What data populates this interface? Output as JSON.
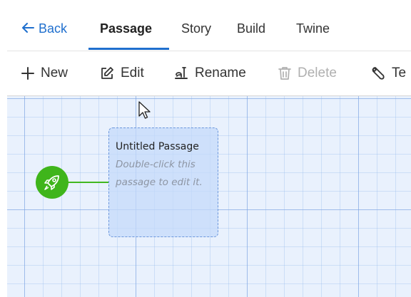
{
  "nav": {
    "back_label": "Back",
    "tabs": [
      {
        "label": "Passage",
        "active": true
      },
      {
        "label": "Story"
      },
      {
        "label": "Build"
      },
      {
        "label": "Twine"
      }
    ]
  },
  "toolbar": {
    "new_label": "New",
    "edit_label": "Edit",
    "rename_label": "Rename",
    "delete_label": "Delete",
    "test_label": "Te"
  },
  "passage": {
    "title": "Untitled Passage",
    "excerpt": "Double-click this passage to edit it."
  },
  "icons": {
    "back": "arrow-left-icon",
    "new": "plus-icon",
    "edit": "edit-icon",
    "rename": "rename-icon",
    "delete": "trash-icon",
    "test": "tool-icon",
    "start": "rocket-icon",
    "cursor": "mouse-pointer"
  },
  "colors": {
    "accent": "#1f6fce",
    "start": "#3fb51b",
    "canvas": "#e9f1fd",
    "card": "#c4d9fa",
    "disabled": "#b0b0b0"
  }
}
